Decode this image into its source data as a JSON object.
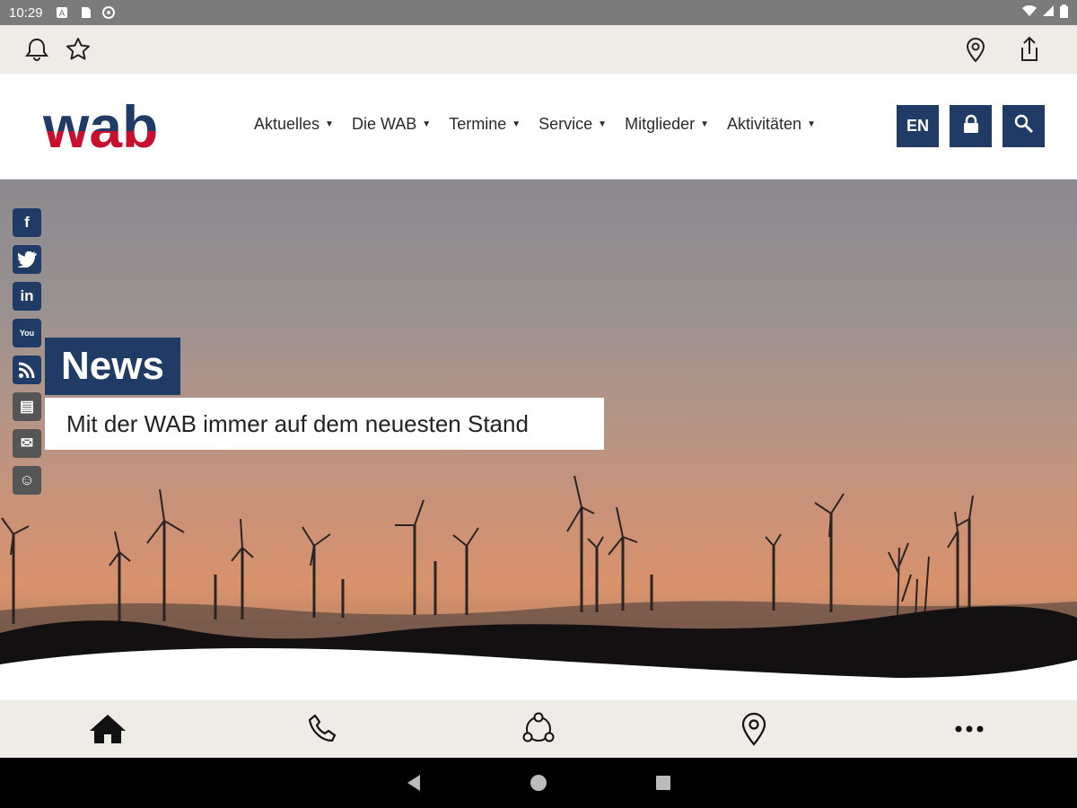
{
  "status_bar": {
    "time": "10:29",
    "icons": [
      "notification-a-icon",
      "sd-card-icon",
      "sync-icon"
    ],
    "right_icons": [
      "wifi-icon",
      "signal-icon",
      "battery-icon"
    ]
  },
  "app_bar": {
    "left_icons": [
      "bell-icon",
      "star-icon"
    ],
    "right_icons": [
      "location-pin-icon",
      "share-icon"
    ]
  },
  "site": {
    "logo_text": "wab",
    "nav": [
      {
        "label": "Aktuelles"
      },
      {
        "label": "Die WAB"
      },
      {
        "label": "Termine"
      },
      {
        "label": "Service"
      },
      {
        "label": "Mitglieder"
      },
      {
        "label": "Aktivitäten"
      }
    ],
    "lang_button": "EN",
    "colors": {
      "brand_blue": "#1f3b66",
      "brand_red": "#c8102e"
    }
  },
  "social": [
    {
      "name": "facebook-icon",
      "glyph": "f"
    },
    {
      "name": "twitter-icon",
      "glyph": "t"
    },
    {
      "name": "linkedin-icon",
      "glyph": "in"
    },
    {
      "name": "youtube-icon",
      "glyph": "You"
    },
    {
      "name": "rss-icon",
      "glyph": "◉"
    },
    {
      "name": "newsletter-icon",
      "glyph": "▤"
    },
    {
      "name": "mail-icon",
      "glyph": "✉"
    },
    {
      "name": "smiley-icon",
      "glyph": "☺"
    }
  ],
  "hero": {
    "title": "News",
    "subtitle": "Mit der WAB immer auf dem neuesten Stand"
  },
  "bottom_nav": [
    "home-icon",
    "phone-icon",
    "network-icon",
    "location-pin-icon",
    "more-icon"
  ]
}
